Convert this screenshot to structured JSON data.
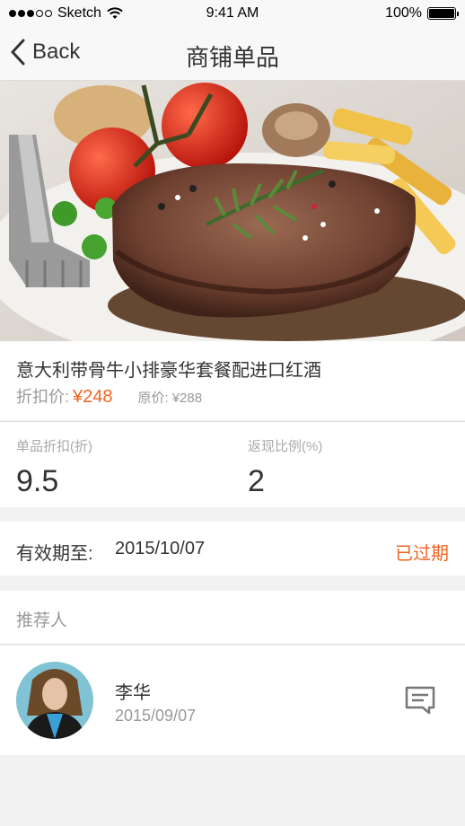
{
  "status_bar": {
    "carrier": "Sketch",
    "time": "9:41 AM",
    "battery": "100%",
    "battery_level": 1.0,
    "signal_strength": 3,
    "signal_max": 5
  },
  "nav": {
    "back_label": "Back",
    "title": "商铺单品"
  },
  "product": {
    "name": "意大利带骨牛小排豪华套餐配进口红酒",
    "price_label": "折扣价:",
    "price": "¥248",
    "original_label": "原价:",
    "original_price": "¥288"
  },
  "stats": {
    "discount_label": "单品折扣(折)",
    "discount_value": "9.5",
    "cashback_label": "返现比例(%)",
    "cashback_value": "2"
  },
  "validity": {
    "label": "有效期至:",
    "date": "2015/10/07",
    "status": "已过期"
  },
  "referrer": {
    "section_title": "推荐人",
    "name": "李华",
    "date": "2015/09/07"
  },
  "colors": {
    "accent": "#f26522",
    "muted": "#999999",
    "background": "#f2f2f2"
  },
  "icons": {
    "back": "chevron-left-icon",
    "wifi": "wifi-icon",
    "battery": "battery-icon",
    "message": "message-icon"
  }
}
